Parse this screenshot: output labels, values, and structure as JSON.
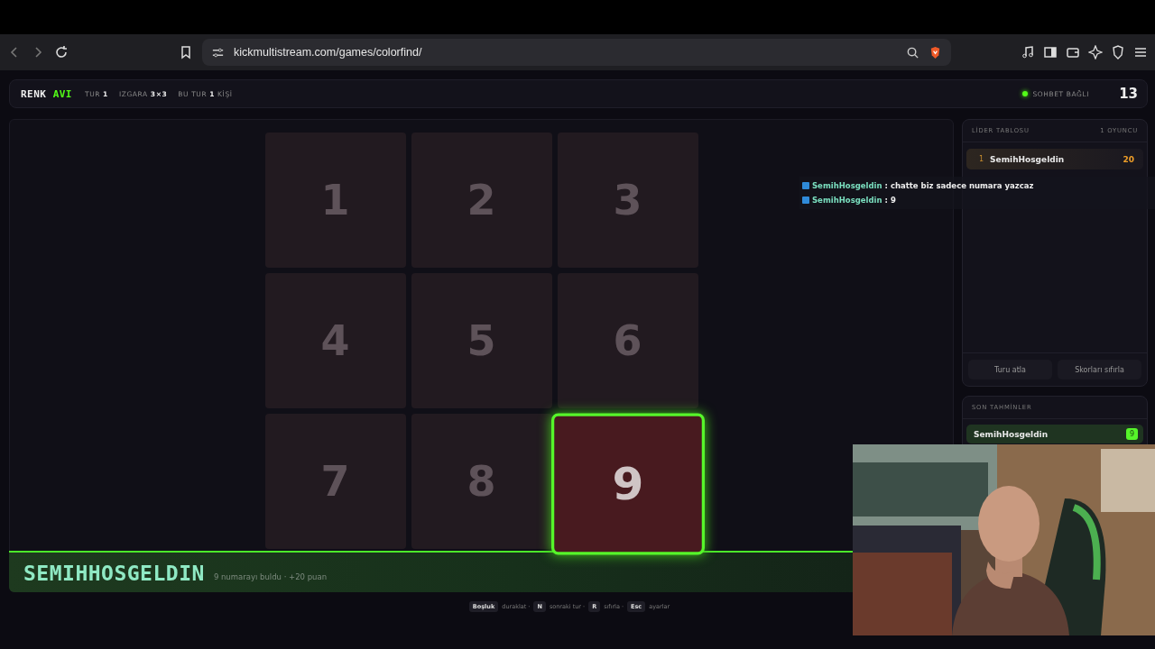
{
  "browser": {
    "url": "kickmultistream.com/games/colorfind/"
  },
  "header": {
    "logo": [
      {
        "text": "RENK",
        "accent": false
      },
      {
        "text": "AVI",
        "accent": true
      }
    ],
    "stats": [
      {
        "label": "TUR",
        "value": "1"
      },
      {
        "label": "IZGARA",
        "value": "3×3"
      },
      {
        "label": "BU TUR",
        "value": "1",
        "unit": "KİŞİ"
      }
    ],
    "status": {
      "text": "SOHBET BAĞLI",
      "connected": true
    },
    "timer": "13"
  },
  "board": {
    "tiles": [
      {
        "label": "1",
        "found": false
      },
      {
        "label": "2",
        "found": false
      },
      {
        "label": "3",
        "found": false
      },
      {
        "label": "4",
        "found": false
      },
      {
        "label": "5",
        "found": false
      },
      {
        "label": "6",
        "found": false
      },
      {
        "label": "7",
        "found": false
      },
      {
        "label": "8",
        "found": false
      },
      {
        "label": "9",
        "found": true
      }
    ]
  },
  "winner": {
    "name": "SEMIHHOSGELDIN",
    "detail": "9 numarayı buldu · +20 puan"
  },
  "chat": [
    {
      "user": "SemihHosgeldin",
      "message": ": chatte biz sadece numara yazcaz"
    },
    {
      "user": "SemihHosgeldin",
      "message": ": 9"
    }
  ],
  "leaderboard": {
    "title": "LİDER TABLOSU",
    "count": "1 OYUNCU",
    "rows": [
      {
        "rank": "1",
        "name": "SemihHosgeldin",
        "score": "20"
      }
    ]
  },
  "buttons": [
    "Turu atla",
    "Skorları sıfırla"
  ],
  "recent": {
    "title": "SON TAHMİNLER",
    "items": [
      {
        "name": "SemihHosgeldin",
        "guess": "9",
        "correct": true
      }
    ]
  },
  "shortcuts": [
    {
      "key": "Boşluk",
      "action": "duraklat ·"
    },
    {
      "key": "N",
      "action": "sonraki tur ·"
    },
    {
      "key": "R",
      "action": "sıfırla ·"
    },
    {
      "key": "Esc",
      "action": "ayarlar"
    }
  ],
  "webcam": {
    "kind": "picture"
  }
}
